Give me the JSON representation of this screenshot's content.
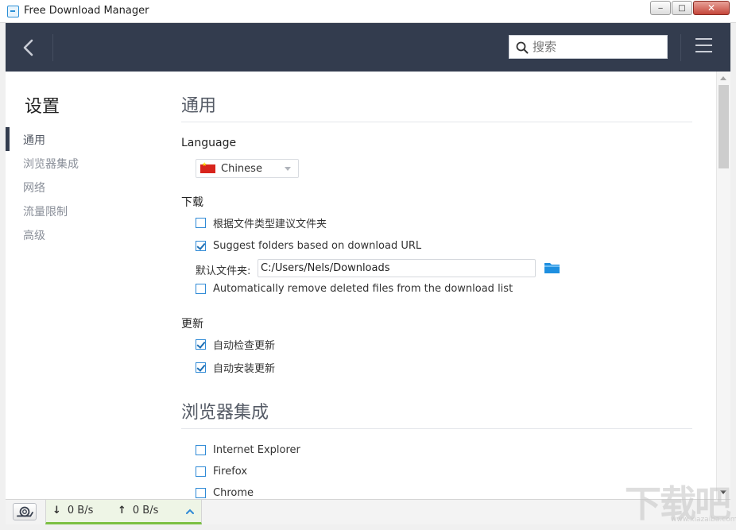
{
  "window": {
    "title": "Free Download Manager",
    "min_label": "‒",
    "max_label": "□",
    "close_label": "✕"
  },
  "header": {
    "search": {
      "placeholder": "搜索",
      "value": ""
    }
  },
  "sidebar": {
    "title": "设置",
    "items": [
      {
        "label": "通用",
        "active": true
      },
      {
        "label": "浏览器集成",
        "active": false
      },
      {
        "label": "网络",
        "active": false
      },
      {
        "label": "流量限制",
        "active": false
      },
      {
        "label": "高级",
        "active": false
      }
    ]
  },
  "general": {
    "title": "通用",
    "language_label": "Language",
    "language_value": "Chinese",
    "download_heading": "下载",
    "download_options": [
      {
        "label": "根据文件类型建议文件夹",
        "checked": false
      },
      {
        "label": "Suggest folders based on download URL",
        "checked": true
      }
    ],
    "default_folder_label": "默认文件夹:",
    "default_folder_value": "C:/Users/Nels/Downloads",
    "auto_remove": {
      "label": "Automatically remove deleted files from the download list",
      "checked": false
    },
    "update_heading": "更新",
    "update_options": [
      {
        "label": "自动检查更新",
        "checked": true
      },
      {
        "label": "自动安装更新",
        "checked": true
      }
    ]
  },
  "browser": {
    "title": "浏览器集成",
    "options": [
      {
        "label": "Internet Explorer",
        "checked": false
      },
      {
        "label": "Firefox",
        "checked": false
      },
      {
        "label": "Chrome",
        "checked": false
      }
    ]
  },
  "status": {
    "download_arrow": "↓",
    "download_speed": "0 B/s",
    "upload_arrow": "↑",
    "upload_speed": "0 B/s"
  },
  "watermark": {
    "text": "下载吧",
    "url": "www.xiazaiba.com"
  },
  "colors": {
    "header_bg": "#333c4e",
    "accent": "#2f8ad6",
    "speed_bar": "#7cc043"
  }
}
